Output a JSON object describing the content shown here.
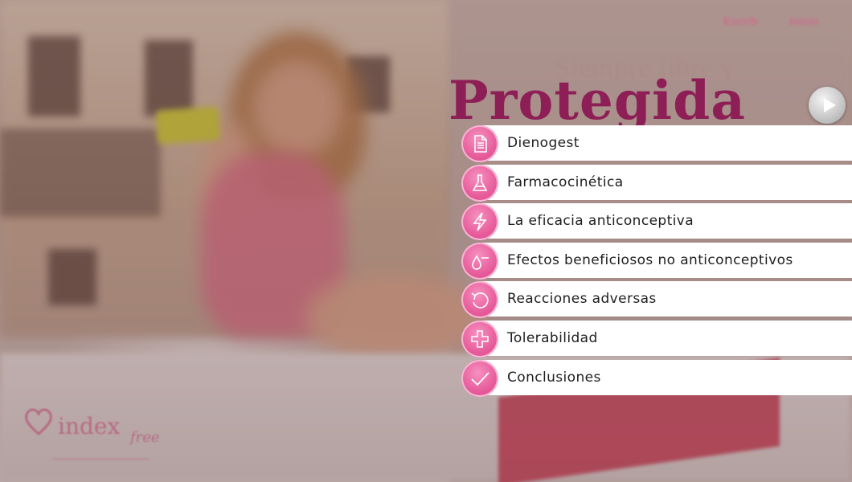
{
  "header": {
    "link_1": "Escrib",
    "link_2": "Inicio"
  },
  "hero": {
    "subtitle": "Siempre libre y",
    "title": "Protegida"
  },
  "menu": {
    "items": [
      {
        "label": "Dienogest",
        "icon": "document-icon"
      },
      {
        "label": "Farmacocinética",
        "icon": "flask-icon"
      },
      {
        "label": "La eficacia anticonceptiva",
        "icon": "lightning-icon"
      },
      {
        "label": "Efectos beneficiosos no anticonceptivos",
        "icon": "drop-minus-icon"
      },
      {
        "label": "Reacciones adversas",
        "icon": "undo-arrow-icon"
      },
      {
        "label": "Tolerabilidad",
        "icon": "plus-icon"
      },
      {
        "label": "Conclusiones",
        "icon": "checkmark-icon"
      }
    ]
  },
  "play_button": {
    "icon": "play-icon"
  },
  "logo": {
    "word_1": "index",
    "word_2": "free"
  },
  "colors": {
    "accent_pink": "#e75b9b",
    "headline": "#8e1f56",
    "menu_bar": "#ffffff"
  }
}
